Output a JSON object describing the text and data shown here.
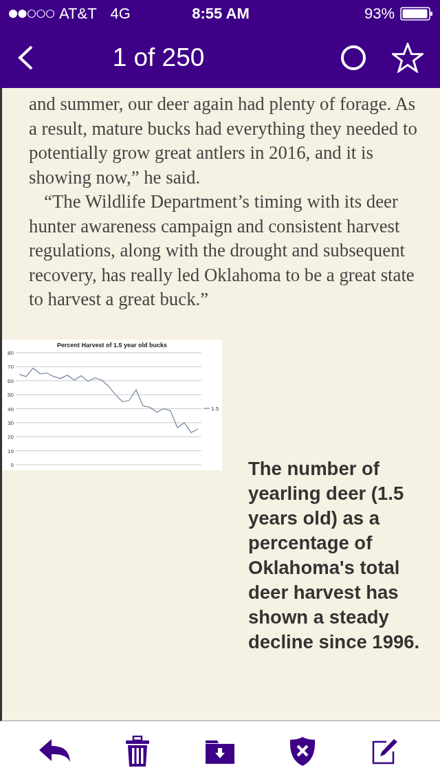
{
  "status_bar": {
    "carrier": "AT&T",
    "network": "4G",
    "time": "8:55 AM",
    "battery": "93%"
  },
  "nav": {
    "title": "1 of 250"
  },
  "article": {
    "paragraphs": [
      {
        "text": "and summer, our deer again had plenty of forage. As a result, mature bucks had everything they needed to potentially grow great antlers in 2016, and it is showing now,” he said.",
        "continued": true
      },
      {
        "text": "“The Wildlife Department’s timing with its deer hunter awareness campaign and consistent harvest regulations, along with the drought and subsequent recovery, has really led Oklahoma to be a great state to harvest a great buck.”",
        "continued": false
      }
    ]
  },
  "figure": {
    "chart_data": {
      "type": "line",
      "title": "Percent Harvest of 1.5 year old bucks",
      "grid": true,
      "series": [
        {
          "name": "1.5",
          "color": "#7a8aa6",
          "values": [
            64.5,
            63,
            69,
            65,
            65.5,
            63,
            61.5,
            64,
            60.5,
            63.5,
            59.5,
            62,
            60.5,
            56,
            50,
            45,
            46,
            53.5,
            42,
            41,
            37.5,
            40,
            38.5,
            26.5,
            30,
            23,
            25.5
          ]
        }
      ],
      "ylim": [
        0,
        80
      ],
      "yticks": [
        0,
        10,
        20,
        30,
        40,
        50,
        60,
        70,
        80
      ]
    },
    "caption": "The number of yearling deer (1.5 years old) as a percentage of Oklahoma's total deer harvest has shown a steady decline since 1996."
  }
}
